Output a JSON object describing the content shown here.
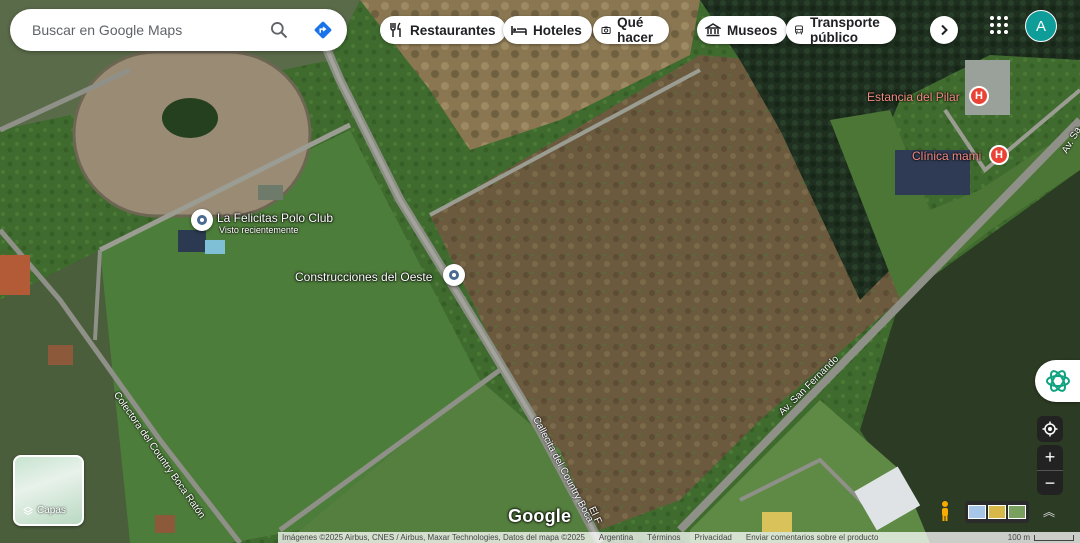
{
  "search": {
    "placeholder": "Buscar en Google Maps"
  },
  "chips": [
    {
      "label": "Restaurantes",
      "icon": "fork-knife-icon"
    },
    {
      "label": "Hoteles",
      "icon": "bed-icon"
    },
    {
      "label": "Qué hacer",
      "icon": "camera-icon"
    },
    {
      "label": "Museos",
      "icon": "museum-icon"
    },
    {
      "label": "Transporte público",
      "icon": "bus-icon"
    }
  ],
  "account": {
    "initial": "A",
    "color": "#0f9d9a"
  },
  "places": {
    "polo_club": {
      "name": "La Felicitas Polo Club",
      "sub": "Visto recientemente"
    },
    "construcciones": {
      "name": "Construcciones del Oeste"
    },
    "estancia": {
      "name": "Estancia del Pilar"
    },
    "clinica": {
      "name": "Clínica mami"
    },
    "hospital_marker": "H"
  },
  "roads": {
    "san_fernando": "Av. San Fernando",
    "san_fernando_top": "Av. Sa",
    "colectora": "Colectora del Country Boca Ratón",
    "callecita": "Callecita del Country Boca",
    "el_f": "El F"
  },
  "layers": {
    "label": "Capas"
  },
  "logo": "Google",
  "footer": {
    "attribution": "Imágenes ©2025 Airbus, CNES / Airbus, Maxar Technologies, Datos del mapa ©2025",
    "country": "Argentina",
    "terms": "Términos",
    "privacy": "Privacidad",
    "feedback": "Enviar comentarios sobre el producto",
    "scale": "100 m"
  },
  "zoom": {
    "in": "+",
    "out": "−"
  },
  "colors": {
    "pin_border": "#4a6a8f",
    "hospital": "#ea4335",
    "hospital_label": "#f28b82"
  }
}
